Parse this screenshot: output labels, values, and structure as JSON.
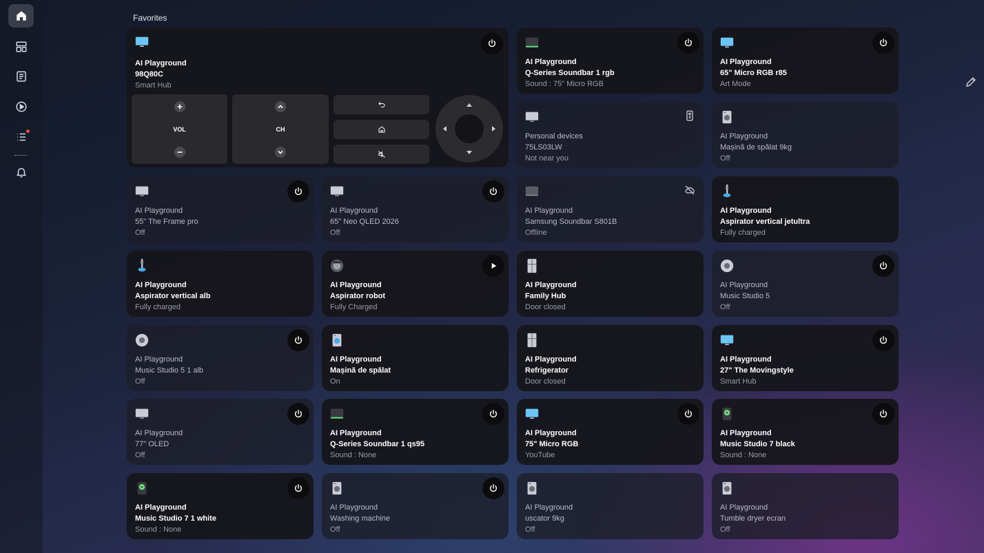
{
  "sidebar": {
    "items": [
      {
        "icon": "home-icon",
        "active": true
      },
      {
        "icon": "dashboard-icon"
      },
      {
        "icon": "list-doc-icon"
      },
      {
        "icon": "play-icon"
      },
      {
        "icon": "routines-icon",
        "badge": true
      },
      {
        "icon": "bell-icon"
      }
    ]
  },
  "section_title": "Favorites",
  "main_card": {
    "line1": "AI Playground",
    "line2": "98Q80C",
    "line3": "Smart Hub",
    "vol_label": "VOL",
    "ch_label": "CH"
  },
  "cards": [
    {
      "icon": "soundbar-icon",
      "line1": "AI Playground",
      "line2": "Q-Series Soundbar 1 rgb",
      "line3": "Sound : 75\" Micro RGB",
      "action": "power",
      "dim": false
    },
    {
      "icon": "tv-icon",
      "line1": "AI Playground",
      "line2": "65\" Micro RGB r85",
      "line3": "Art Mode",
      "action": "power",
      "dim": false
    },
    {
      "icon": "tv-gray-icon",
      "line1": "Personal devices",
      "line2": "75LS03LW",
      "line3": "Not near you",
      "action": "remote",
      "dim": true
    },
    {
      "icon": "washer-icon",
      "line1": "AI Playground",
      "line2": "Mașină de spălat 9kg",
      "line3": "Off",
      "action": "none",
      "dim": true
    },
    {
      "icon": "tv-gray-icon",
      "line1": "AI Playground",
      "line2": "55\" The Frame pro",
      "line3": "Off",
      "action": "power",
      "dim": true
    },
    {
      "icon": "tv-gray-icon",
      "line1": "AI Playground",
      "line2": "65\" Neo QLED 2026",
      "line3": "Off",
      "action": "power",
      "dim": true
    },
    {
      "icon": "soundbar-gray-icon",
      "line1": "AI Playground",
      "line2": "Samsung Soundbar S801B",
      "line3": "Offline",
      "action": "offline",
      "dim": true
    },
    {
      "icon": "stick-vacuum-icon",
      "line1": "AI Playground",
      "line2": "Aspirator vertical jetultra",
      "line3": "Fully charged",
      "action": "none",
      "dim": false
    },
    {
      "icon": "stick-vacuum-icon",
      "line1": "AI Playground",
      "line2": "Aspirator vertical alb",
      "line3": "Fully charged",
      "action": "none",
      "dim": false
    },
    {
      "icon": "robot-vacuum-icon",
      "line1": "AI Playground",
      "line2": "Aspirator robot",
      "line3": "Fully Charged",
      "action": "play",
      "dim": false
    },
    {
      "icon": "fridge-icon",
      "line1": "AI Playground",
      "line2": "Family Hub",
      "line3": "Door closed",
      "action": "none",
      "dim": false
    },
    {
      "icon": "speaker-round-icon",
      "line1": "AI Playground",
      "line2": "Music Studio 5",
      "line3": "Off",
      "action": "power",
      "dim": true
    },
    {
      "icon": "speaker-round-icon",
      "line1": "AI Playground",
      "line2": "Music Studio 5 1 alb",
      "line3": "Off",
      "action": "power",
      "dim": true
    },
    {
      "icon": "washer-blue-icon",
      "line1": "AI Playground",
      "line2": "Mașină de spălat",
      "line3": "On",
      "action": "none",
      "dim": false
    },
    {
      "icon": "fridge-icon",
      "line1": "AI Playground",
      "line2": "Refrigerator",
      "line3": "Door closed",
      "action": "none",
      "dim": false
    },
    {
      "icon": "tv-icon",
      "line1": "AI Playground",
      "line2": "27\" The Movingstyle",
      "line3": "Smart Hub",
      "action": "power",
      "dim": false
    },
    {
      "icon": "tv-gray-icon",
      "line1": "AI Playground",
      "line2": "77\" OLED",
      "line3": "Off",
      "action": "power",
      "dim": true
    },
    {
      "icon": "soundbar-icon",
      "line1": "AI Playground",
      "line2": "Q-Series Soundbar 1 qs95",
      "line3": "Sound : None",
      "action": "power",
      "dim": false
    },
    {
      "icon": "tv-icon",
      "line1": "AI Playground",
      "line2": "75\" Micro RGB",
      "line3": "YouTube",
      "action": "power",
      "dim": false
    },
    {
      "icon": "speaker-green-icon",
      "line1": "AI Playground",
      "line2": "Music Studio 7 black",
      "line3": "Sound : None",
      "action": "power",
      "dim": false
    },
    {
      "icon": "speaker-green-icon",
      "line1": "AI Playground",
      "line2": "Music Studio 7 1 white",
      "line3": "Sound : None",
      "action": "power",
      "dim": false
    },
    {
      "icon": "washer-icon",
      "line1": "AI Playground",
      "line2": "Washing machine",
      "line3": "Off",
      "action": "power",
      "dim": true
    },
    {
      "icon": "washer-icon",
      "line1": "AI Playground",
      "line2": "uscator 9kg",
      "line3": "Off",
      "action": "none",
      "dim": true
    },
    {
      "icon": "washer-icon",
      "line1": "AI Playground",
      "line2": "Tumble dryer ecran",
      "line3": "Off",
      "action": "none",
      "dim": true
    }
  ],
  "edit_icon": "pencil-icon"
}
